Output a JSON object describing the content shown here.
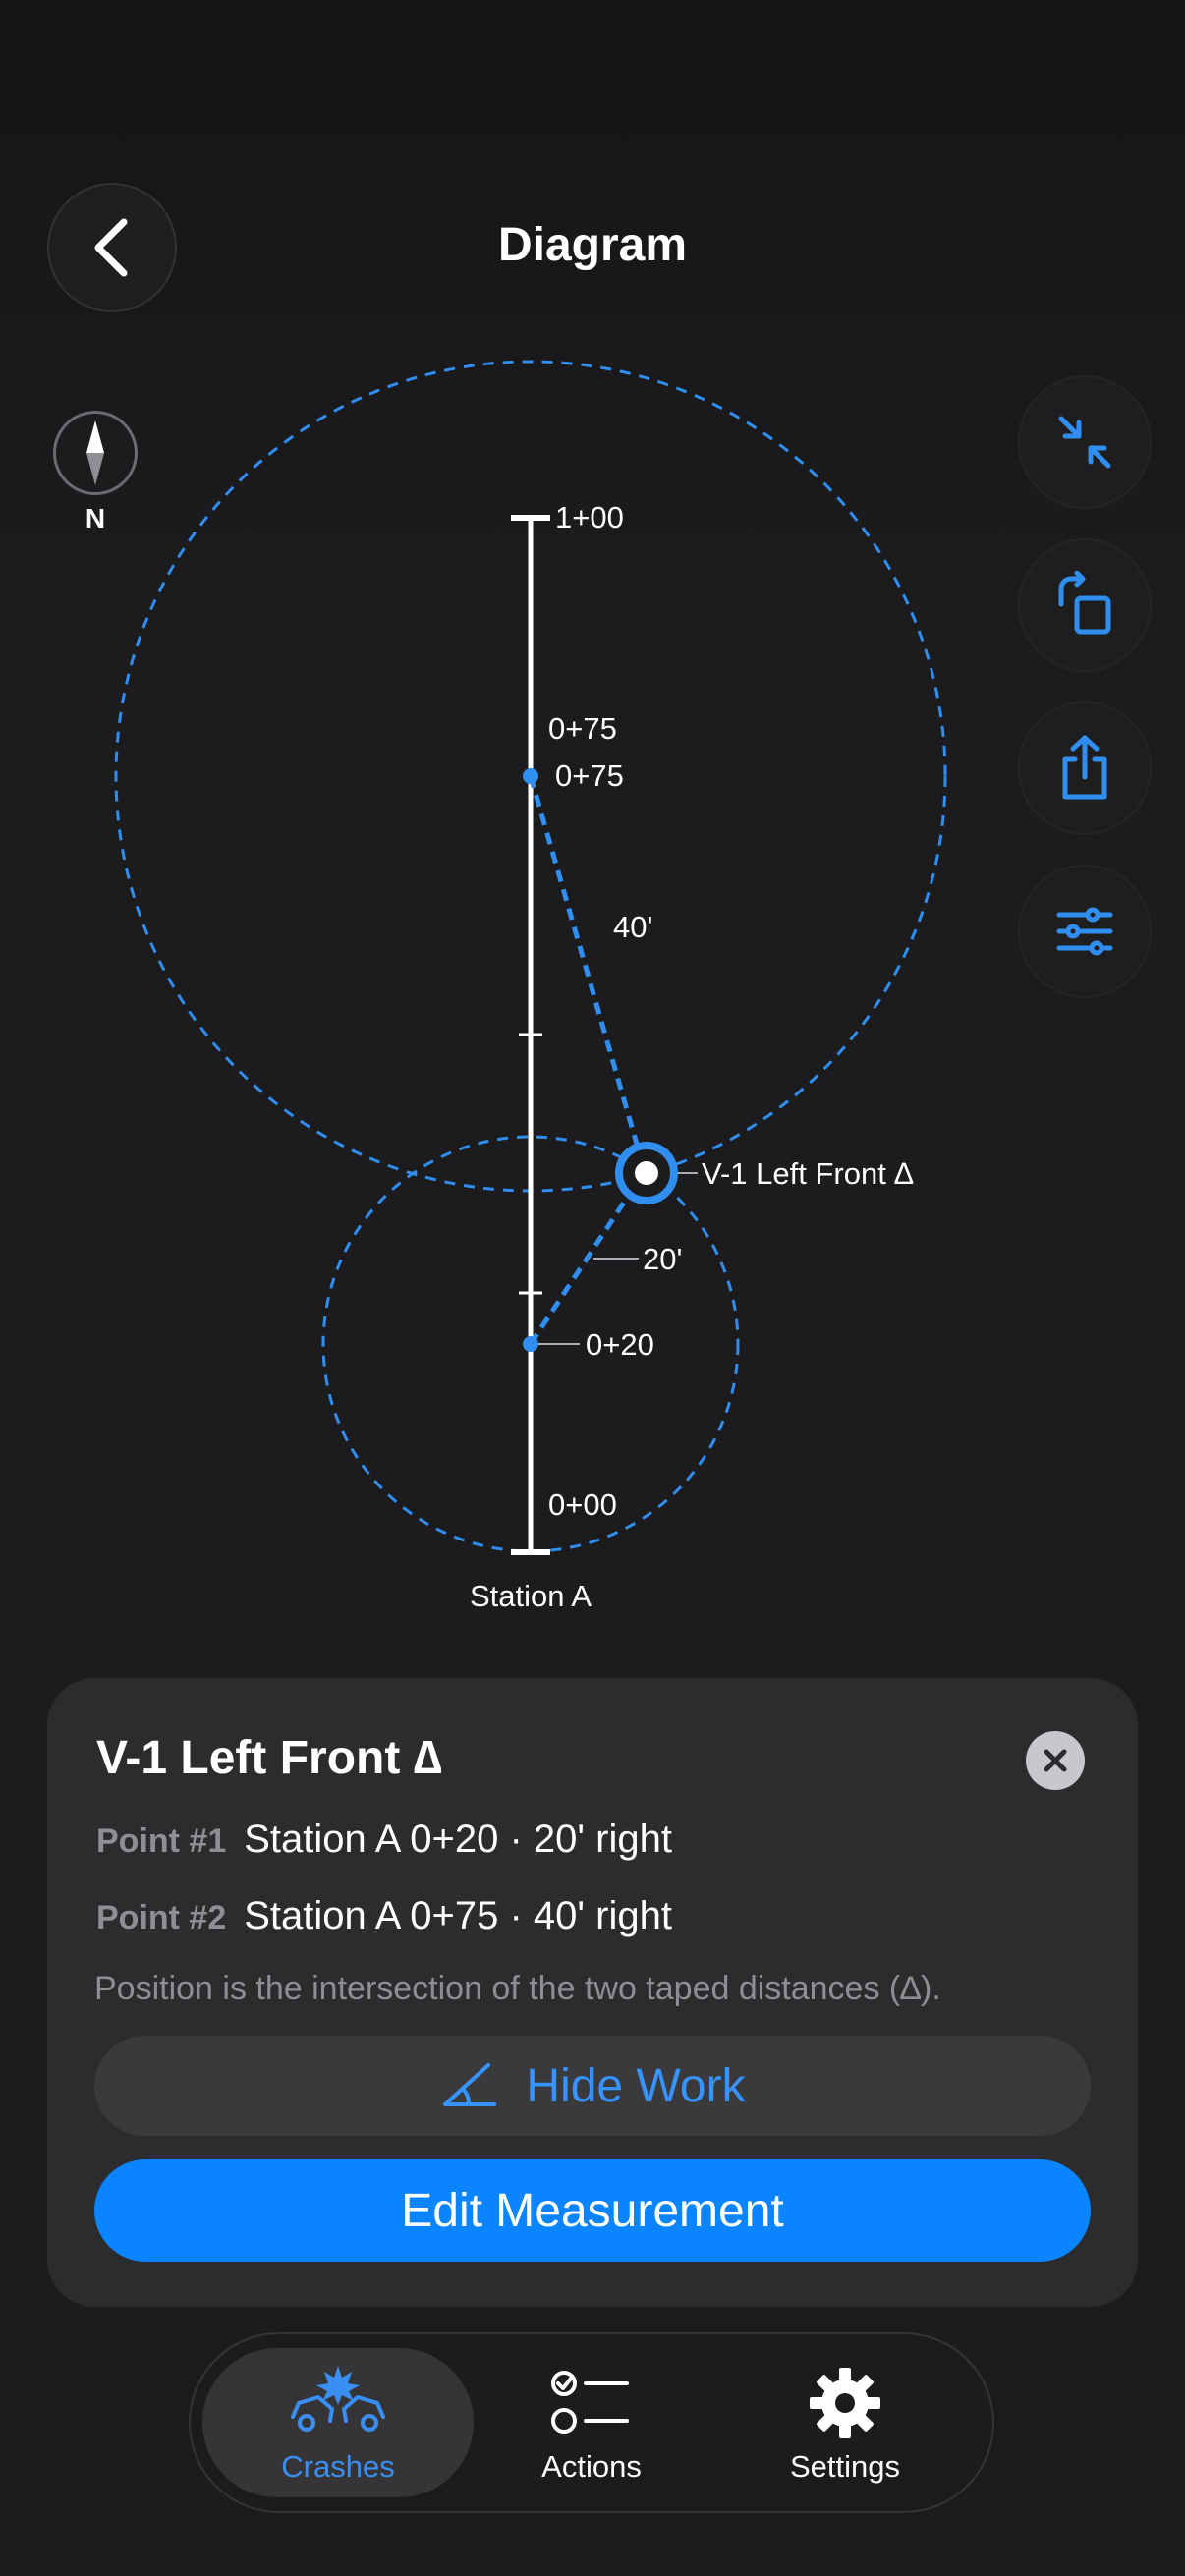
{
  "header": {
    "title": "Diagram"
  },
  "compass": {
    "label": "N"
  },
  "diagram": {
    "station_label": "Station A",
    "tick_top": "1+00",
    "label_075_upper": "0+75",
    "label_075": "0+75",
    "label_020": "0+20",
    "label_000": "0+00",
    "distance_1": "40'",
    "distance_2": "20'",
    "point_label": "V-1 Left Front ∆"
  },
  "card": {
    "title": "V-1 Left Front ∆",
    "point1_label": "Point #1",
    "point1_value": "Station A 0+20 · 20' right",
    "point2_label": "Point #2",
    "point2_value": "Station A 0+75 · 40' right",
    "note": "Position is the intersection of the two taped distances (∆).",
    "hide_work_label": "Hide Work",
    "edit_label": "Edit Measurement"
  },
  "tabs": {
    "crashes": "Crashes",
    "actions": "Actions",
    "settings": "Settings"
  },
  "colors": {
    "accent": "#0a84ff",
    "dashed": "#2f8ef0",
    "background": "#1c1c1e",
    "card": "#2c2c2e"
  },
  "icons": {
    "back": "chevron-left-icon",
    "compass": "compass-icon",
    "collapse": "collapse-arrows-icon",
    "rotate": "rotate-icon",
    "share": "share-icon",
    "filters": "sliders-icon",
    "close": "close-icon",
    "hide_work": "angle-icon",
    "crashes": "crash-icon",
    "actions": "checklist-icon",
    "settings": "gear-icon"
  }
}
